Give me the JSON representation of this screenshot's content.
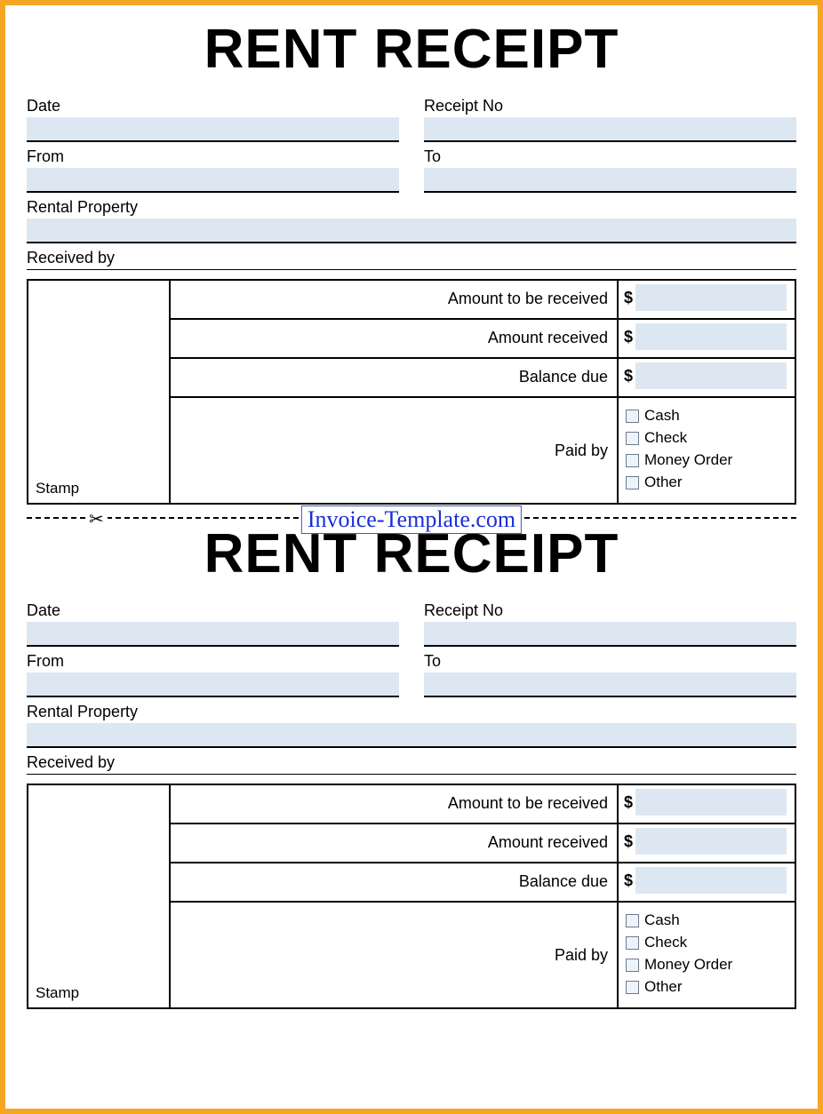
{
  "receipt": {
    "title": "RENT RECEIPT",
    "fields": {
      "date": "Date",
      "receipt_no": "Receipt No",
      "from": "From",
      "to": "To",
      "rental_property": "Rental Property",
      "received_by": "Received by"
    },
    "amounts": {
      "to_be_received_label": "Amount to be received",
      "received_label": "Amount received",
      "balance_due_label": "Balance due",
      "currency_symbol": "$",
      "to_be_received_value": "",
      "received_value": "",
      "balance_due_value": ""
    },
    "paid_by": {
      "label": "Paid by",
      "options": [
        "Cash",
        "Check",
        "Money Order",
        "Other"
      ]
    },
    "stamp_label": "Stamp"
  },
  "divider": {
    "scissors": "✂",
    "link_text": "Invoice-Template.com"
  }
}
